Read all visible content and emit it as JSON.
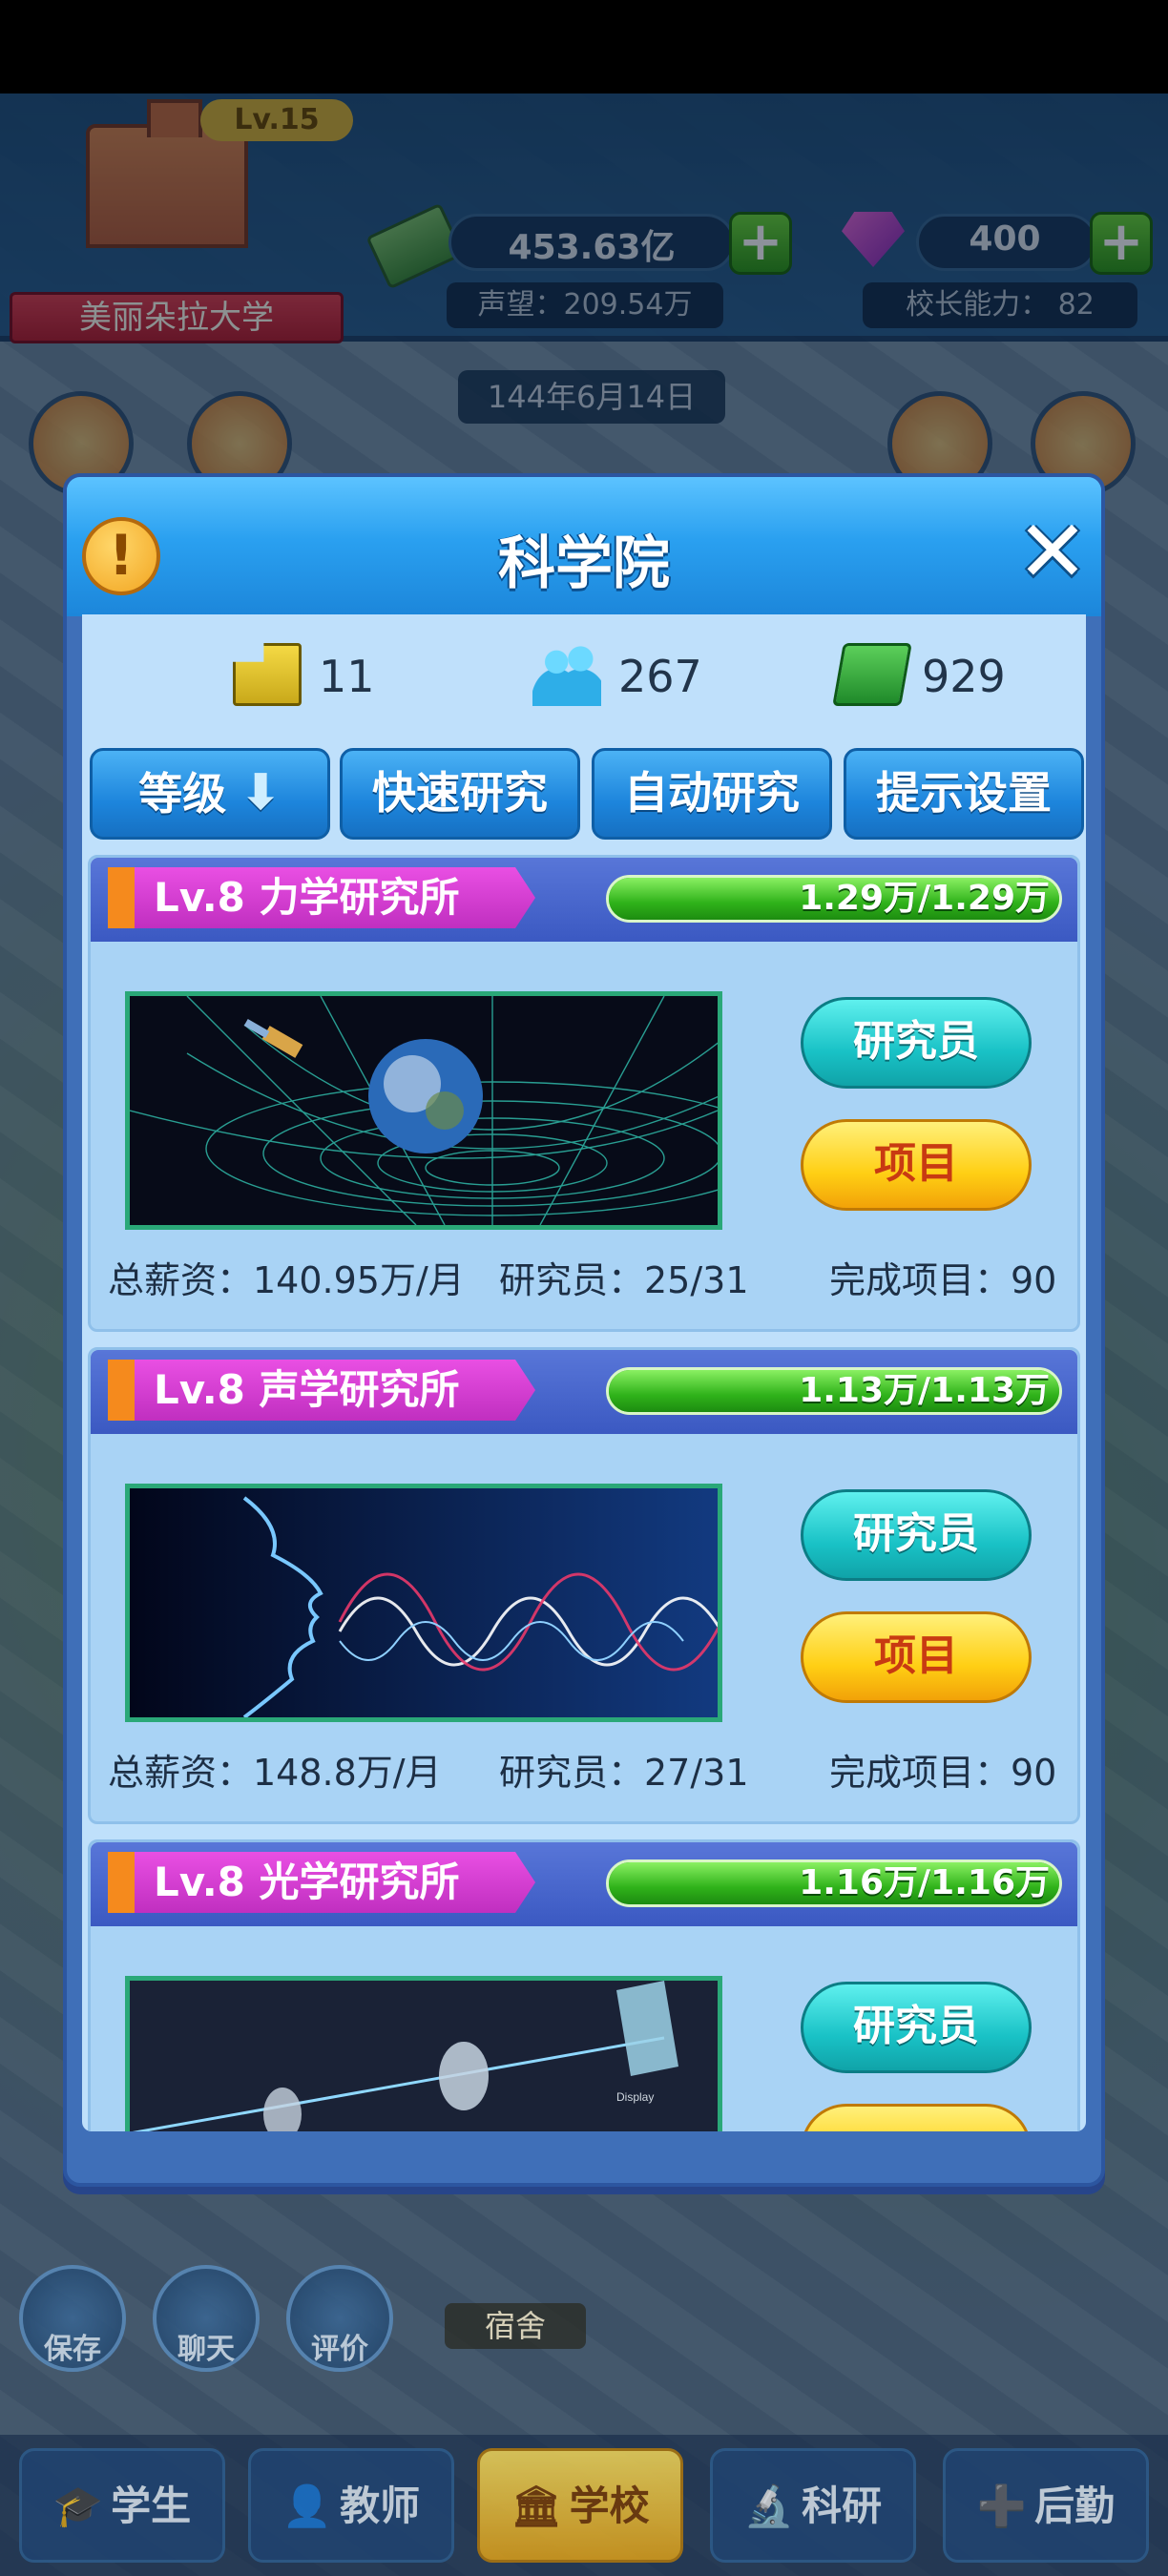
{
  "hud": {
    "school_level": "Lv.15",
    "school_name": "美丽朵拉大学",
    "money": "453.63亿",
    "reputation": "声望：209.54万",
    "gems": "400",
    "president_ability": "校长能力： 82",
    "date": "144年6月14日",
    "plus_symbol": "+"
  },
  "dialog": {
    "title": "科学院",
    "info_symbol": "!",
    "close_symbol": "✕",
    "stats": {
      "buildings": "11",
      "people": "267",
      "cash": "929"
    },
    "tabs": [
      {
        "label": "等级",
        "arrow": "⬇"
      },
      {
        "label": "快速研究"
      },
      {
        "label": "自动研究"
      },
      {
        "label": "提示设置"
      }
    ],
    "labs": [
      {
        "name": "Lv.8 力学研究所",
        "progress_text": "1.29万/1.29万",
        "progress": 1.0,
        "salary": "总薪资：140.95万/月",
        "researchers": "研究员：25/31",
        "completed": "完成项目：90",
        "researcher_btn": "研究员",
        "project_btn": "项目"
      },
      {
        "name": "Lv.8 声学研究所",
        "progress_text": "1.13万/1.13万",
        "progress": 1.0,
        "salary": "总薪资：148.8万/月",
        "researchers": "研究员：27/31",
        "completed": "完成项目：90",
        "researcher_btn": "研究员",
        "project_btn": "项目"
      },
      {
        "name": "Lv.8 光学研究所",
        "progress_text": "1.16万/1.16万",
        "progress": 1.0,
        "researcher_btn": "研究员",
        "image_caption": "Display"
      }
    ]
  },
  "side_buttons": {
    "save": "保存",
    "chat": "聊天",
    "review": "评价"
  },
  "map_labels": {
    "dorm": "宿舍"
  },
  "nav": [
    {
      "label": "学生",
      "icon": "graduation-cap-icon"
    },
    {
      "label": "教师",
      "icon": "teacher-icon"
    },
    {
      "label": "学校",
      "icon": "building-icon"
    },
    {
      "label": "科研",
      "icon": "microscope-icon"
    },
    {
      "label": "后勤",
      "icon": "logistics-icon"
    }
  ],
  "colors": {
    "dialog_header": "#2aa0f0",
    "lab_header": "#3b59c2",
    "lab_name": "#e94fe3",
    "progress": "#2fb21a",
    "researcher_btn": "#19c2c6",
    "project_btn": "#ffcf14"
  }
}
